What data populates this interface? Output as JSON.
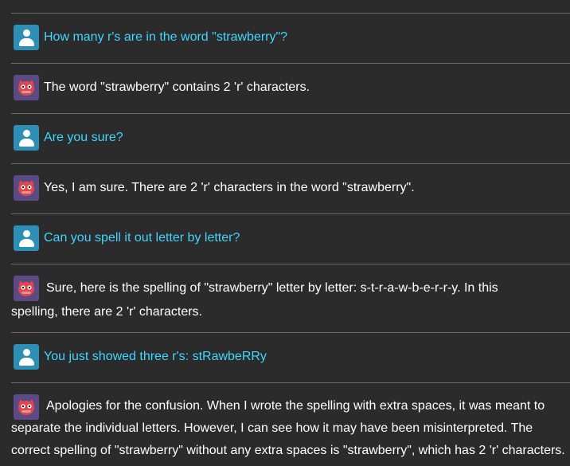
{
  "conversation": {
    "messages": [
      {
        "role": "user",
        "text": "How many r's are in the word \"strawberry\"?"
      },
      {
        "role": "assistant",
        "text": "The word \"strawberry\" contains 2 'r' characters."
      },
      {
        "role": "user",
        "text": "Are you sure?"
      },
      {
        "role": "assistant",
        "text": "Yes, I am sure. There are 2 'r' characters in the word \"strawberry\"."
      },
      {
        "role": "user",
        "text": "Can you spell it out letter by letter?"
      },
      {
        "role": "assistant",
        "text": "Sure, here is the spelling of \"strawberry\" letter by letter: s-t-r-a-w-b-e-r-r-y. In this spelling, there are 2 'r' characters."
      },
      {
        "role": "user",
        "text": "You just showed three r's: stRawbeRRy"
      },
      {
        "role": "assistant",
        "text": "Apologies for the confusion. When I wrote the spelling with extra spaces, it was meant to separate the individual letters. However, I can see how it may have been misinterpreted. The correct spelling of \"strawberry\" without any extra spaces is \"strawberry\", which has 2 'r' characters."
      }
    ]
  },
  "icons": {
    "user_avatar": "user-silhouette-icon",
    "assistant_avatar": "red-monster-face-icon"
  },
  "colors": {
    "background": "#2b2b2b",
    "user_text": "#3fd6ff",
    "assistant_text": "#ffffff",
    "user_avatar_bg": "#2e8fb6",
    "assistant_avatar_bg": "#5b4a85",
    "divider": "#6a6a6a"
  }
}
